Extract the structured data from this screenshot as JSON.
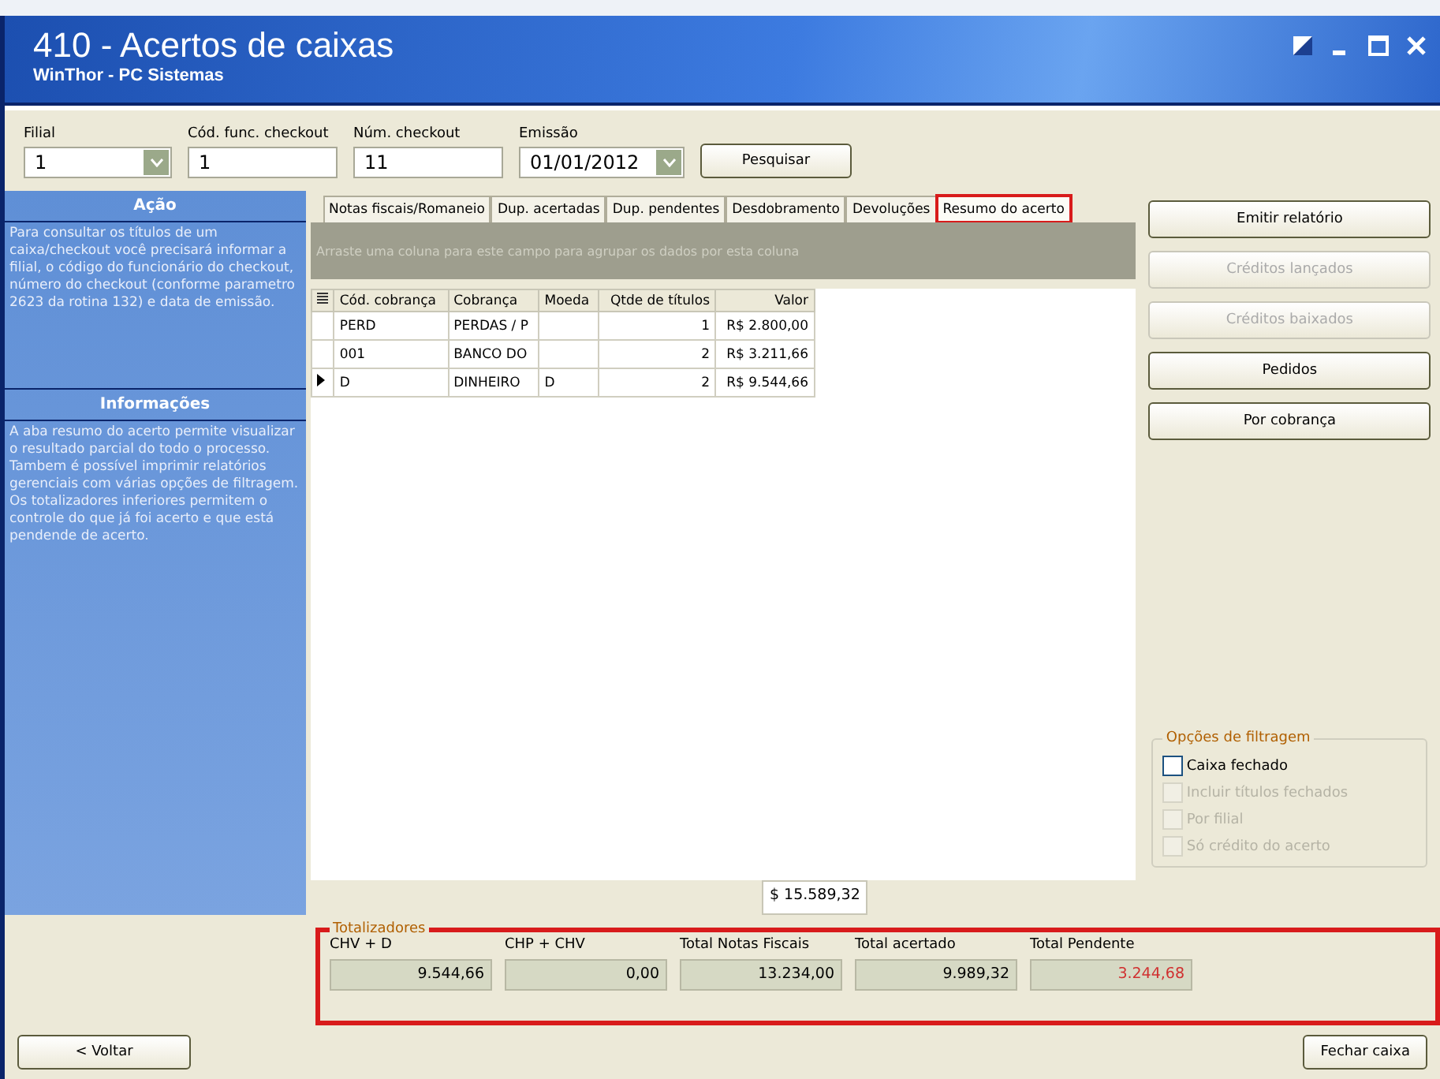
{
  "window": {
    "title": "410 - Acertos de caixas",
    "subtitle": "WinThor - PC Sistemas"
  },
  "filters": [
    {
      "kind": "select",
      "label": "Filial",
      "value": "1"
    },
    {
      "kind": "text",
      "label": "Cód. func. checkout",
      "value": "1"
    },
    {
      "kind": "text",
      "label": "Núm. checkout",
      "value": "11"
    },
    {
      "kind": "select",
      "label": "Emissão",
      "value": "01/01/2012"
    }
  ],
  "search_button": "Pesquisar",
  "sidebar": {
    "sections": [
      {
        "title": "Ação",
        "text": "Para consultar os títulos de um caixa/checkout você precisará informar a filial, o código do funcionário do checkout, número do checkout (conforme parametro 2623 da rotina 132) e data de emissão."
      },
      {
        "title": "Informações",
        "text": "A aba resumo do acerto permite visualizar o resultado parcial do todo o processo. Tambem é possível imprimir relatórios gerenciais com várias opções de filtragem. Os totalizadores inferiores permitem o controle do que já foi acerto e que está pendende de acerto."
      }
    ]
  },
  "tabs": [
    {
      "label": "Notas fiscais/Romaneio",
      "selected": false,
      "highlighted": false
    },
    {
      "label": "Dup. acertadas",
      "selected": false,
      "highlighted": false
    },
    {
      "label": "Dup. pendentes",
      "selected": false,
      "highlighted": false
    },
    {
      "label": "Desdobramento",
      "selected": false,
      "highlighted": false
    },
    {
      "label": "Devoluções",
      "selected": false,
      "highlighted": false
    },
    {
      "label": "Resumo do acerto",
      "selected": true,
      "highlighted": true
    }
  ],
  "group_hint": "Arraste uma coluna para este campo para agrupar os dados por esta coluna",
  "table": {
    "columns": [
      "Cód. cobrança",
      "Cobrança",
      "Moeda",
      "Qtde de títulos",
      "Valor"
    ],
    "rows": [
      {
        "cells": [
          "PERD",
          "PERDAS / P",
          "",
          "1",
          "R$ 2.800,00"
        ],
        "selected": false
      },
      {
        "cells": [
          "001",
          "BANCO DO",
          "",
          "2",
          "R$ 3.211,66"
        ],
        "selected": false
      },
      {
        "cells": [
          "D",
          "DINHEIRO",
          "D",
          "2",
          "R$ 9.544,66"
        ],
        "selected": true
      }
    ],
    "footer_total": "$ 15.589,32"
  },
  "actions": [
    {
      "label": "Emitir relatório",
      "disabled": false
    },
    {
      "label": "Créditos lançados",
      "disabled": true
    },
    {
      "label": "Créditos baixados",
      "disabled": true
    },
    {
      "label": "Pedidos",
      "disabled": false
    },
    {
      "label": "Por cobrança",
      "disabled": false
    }
  ],
  "filter_options": {
    "title": "Opções de filtragem",
    "items": [
      {
        "label": "Caixa fechado",
        "checked": false,
        "disabled": false
      },
      {
        "label": "Incluir títulos fechados",
        "checked": false,
        "disabled": true
      },
      {
        "label": "Por filial",
        "checked": false,
        "disabled": true
      },
      {
        "label": "Só crédito do acerto",
        "checked": false,
        "disabled": true
      }
    ]
  },
  "totals": {
    "title": "Totalizadores",
    "highlighted": true,
    "items": [
      {
        "label": "CHV + D",
        "value": "9.544,66",
        "negative": false
      },
      {
        "label": "CHP + CHV",
        "value": "0,00",
        "negative": false
      },
      {
        "label": "Total Notas Fiscais",
        "value": "13.234,00",
        "negative": false
      },
      {
        "label": "Total acertado",
        "value": "9.989,32",
        "negative": false
      },
      {
        "label": "Total Pendente",
        "value": "3.244,68",
        "negative": true
      }
    ]
  },
  "footer": {
    "back_button": "< Voltar",
    "close_button": "Fechar caixa"
  }
}
